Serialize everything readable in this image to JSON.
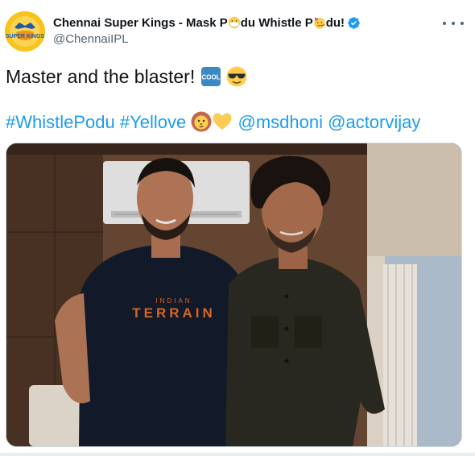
{
  "account": {
    "display_name_prefix": "Chennai Super Kings - Mask P",
    "display_name_mid": "du Whistle P",
    "display_name_suffix": "du!",
    "handle": "@ChennaiIPL",
    "avatar_text": "SUPER KINGS"
  },
  "tweet": {
    "text": "Master and the blaster!",
    "hashtags": [
      "#WhistlePodu",
      "#Yellove"
    ],
    "mentions": [
      "@msdhoni",
      "@actorvijay"
    ],
    "cool_label": "COOL"
  },
  "shirt_text": {
    "top": "INDIAN",
    "main": "TERRAIN"
  },
  "colors": {
    "link": "#1d9bf0",
    "verified": "#1d9bf0",
    "brand_yellow": "#f8c31a",
    "text_primary": "#0f1419",
    "text_secondary": "#536471"
  }
}
